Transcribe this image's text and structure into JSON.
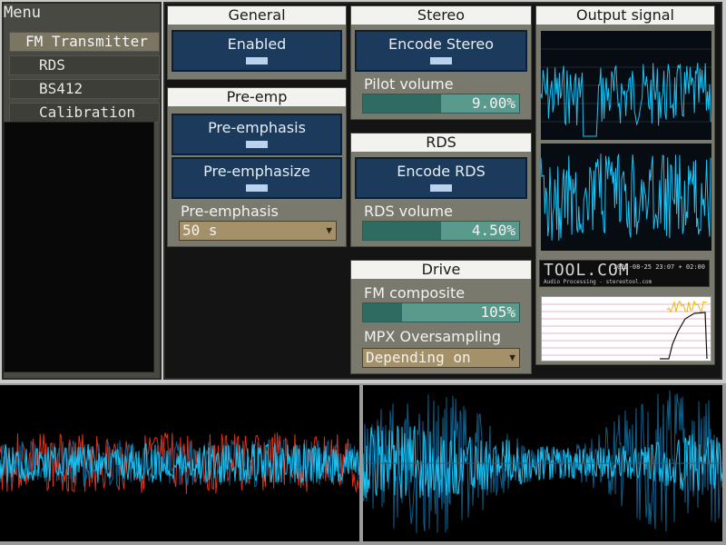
{
  "menu": {
    "title": "Menu",
    "items": [
      {
        "label": "FM Transmitter",
        "selected": true
      },
      {
        "label": "RDS",
        "selected": false
      },
      {
        "label": "BS412",
        "selected": false
      },
      {
        "label": "Calibration",
        "selected": false
      }
    ]
  },
  "general": {
    "title": "General",
    "enabled_label": "Enabled"
  },
  "preemp": {
    "title": "Pre-emp",
    "preemphasis_label": "Pre-emphasis",
    "preemphasize_label": "Pre-emphasize",
    "select_label": "Pre-emphasis",
    "select_value": "50 s"
  },
  "stereo": {
    "title": "Stereo",
    "encode_label": "Encode Stereo",
    "pilot_label": "Pilot volume",
    "pilot_value": "9.00%",
    "pilot_fraction": 0.5
  },
  "rds": {
    "title": "RDS",
    "encode_label": "Encode RDS",
    "volume_label": "RDS volume",
    "volume_value": "4.50%",
    "volume_fraction": 0.5
  },
  "drive": {
    "title": "Drive",
    "composite_label": "FM composite",
    "composite_value": "105%",
    "composite_fraction": 0.25,
    "mpx_label": "MPX Oversampling",
    "mpx_value": "Depending on"
  },
  "output": {
    "title": "Output signal",
    "logo_text": "TOOL.COM",
    "logo_date": "2022-08-25  23:07 + 02:00",
    "logo_sub": "Audio Processing - stereotool.com"
  },
  "colors": {
    "panel_bg": "#7a796e",
    "button_blue": "#1c3a5b",
    "slider_teal": "#5a9a8d",
    "wave_cyan": "#19c4f5",
    "wave_dark": "#0e5e8a",
    "clip_red": "#e0301a",
    "graph_line": "#111111",
    "graph_yellow": "#f0b400"
  }
}
